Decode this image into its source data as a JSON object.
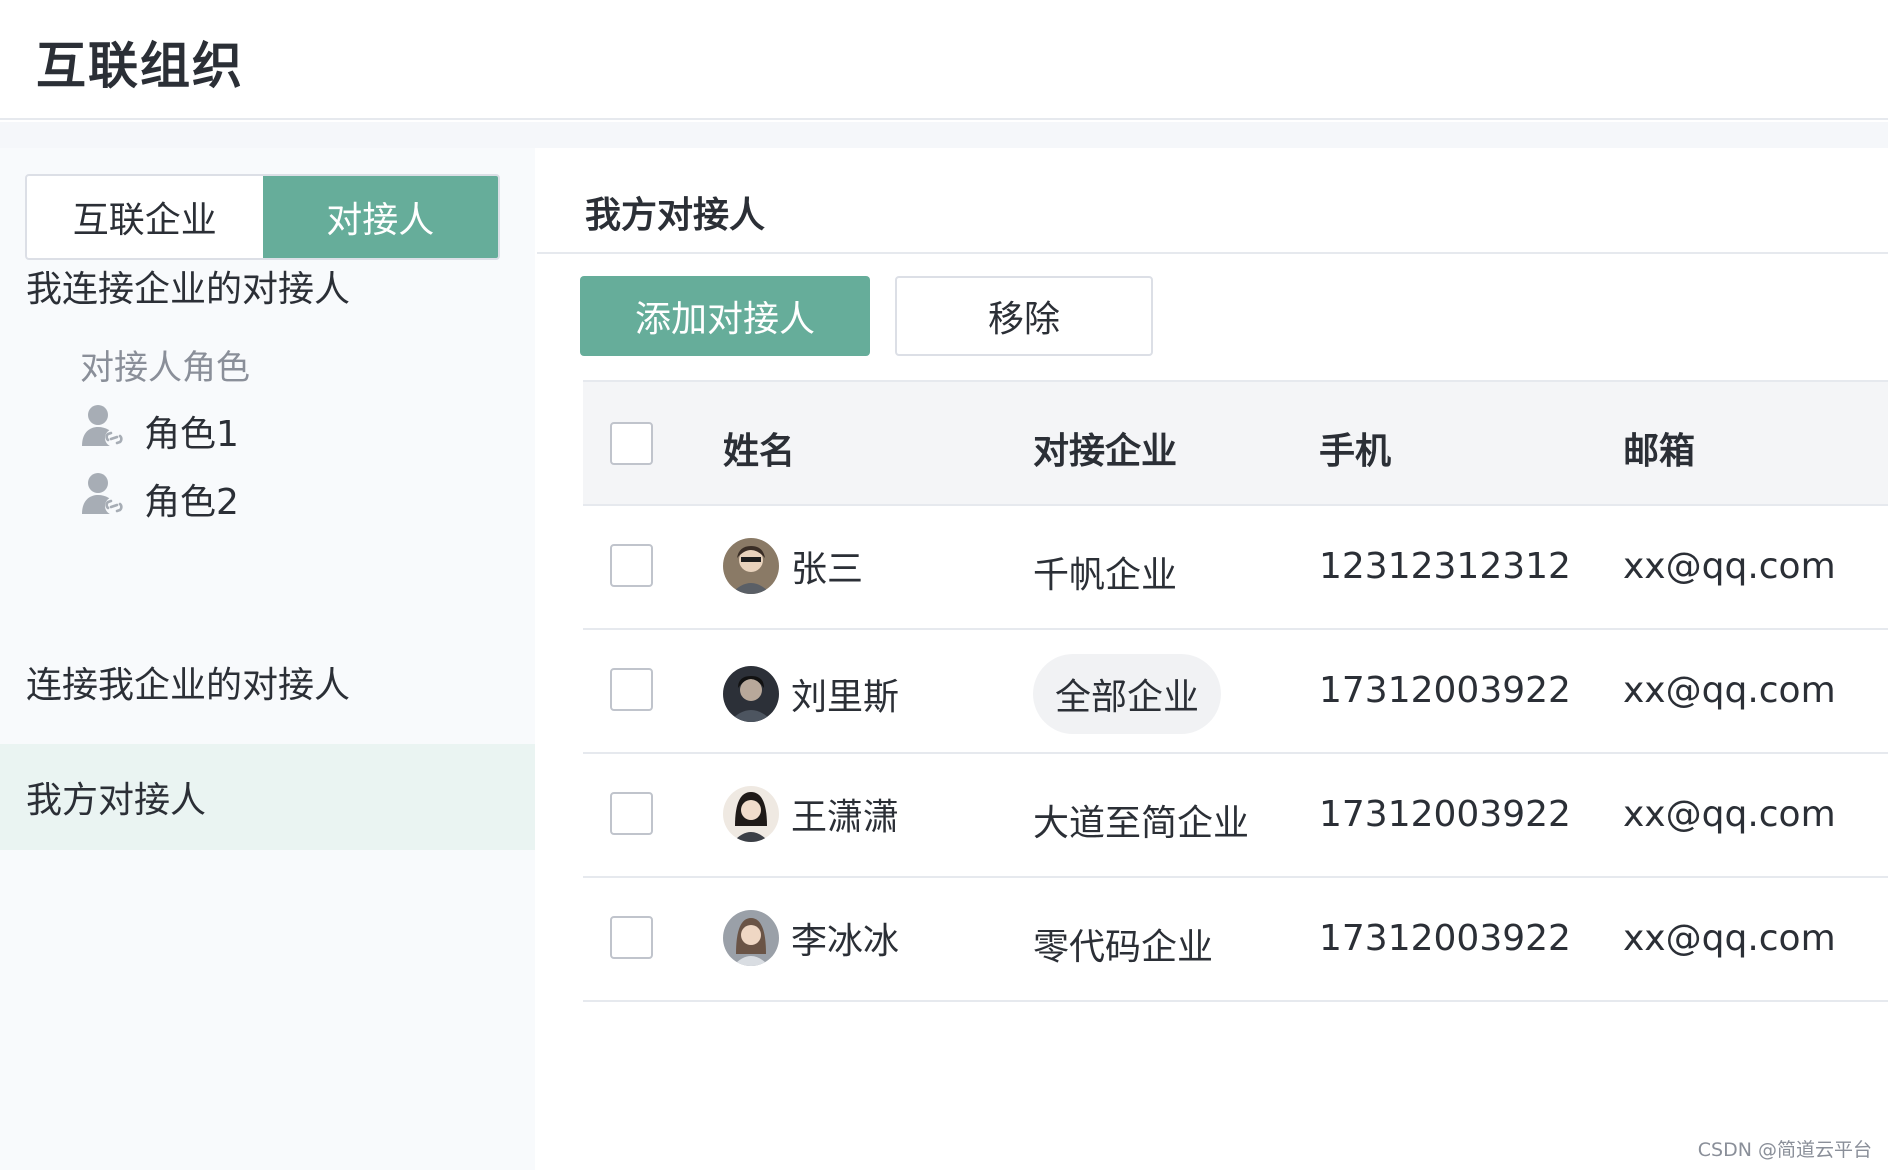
{
  "header": {
    "title": "互联组织"
  },
  "sidebar": {
    "segment": {
      "options": [
        "互联企业",
        "对接人"
      ],
      "active_index": 1
    },
    "group_outgoing": "我连接企业的对接人",
    "role_section_label": "对接人角色",
    "roles": [
      {
        "label": "角色1",
        "icon": "user-link-icon"
      },
      {
        "label": "角色2",
        "icon": "user-link-icon"
      }
    ],
    "group_incoming": "连接我企业的对接人",
    "active_item": "我方对接人"
  },
  "main": {
    "section_title": "我方对接人",
    "buttons": {
      "add": "添加对接人",
      "remove": "移除"
    },
    "table": {
      "columns": [
        "姓名",
        "对接企业",
        "手机",
        "邮箱"
      ],
      "rows": [
        {
          "name": "张三",
          "company": "千帆企业",
          "phone": "12312312312",
          "email": "xx@qq.com",
          "company_pill": false
        },
        {
          "name": "刘里斯",
          "company": "全部企业",
          "phone": "17312003922",
          "email": "xx@qq.com",
          "company_pill": true
        },
        {
          "name": "王潇潇",
          "company": "大道至简企业",
          "phone": "17312003922",
          "email": "xx@qq.com",
          "company_pill": false
        },
        {
          "name": "李冰冰",
          "company": "零代码企业",
          "phone": "17312003922",
          "email": "xx@qq.com",
          "company_pill": false
        }
      ]
    }
  },
  "colors": {
    "accent": "#66ad9a",
    "active_bg": "#eaf4f2",
    "header_bg": "#f4f5f7"
  },
  "watermark": "CSDN @简道云平台"
}
